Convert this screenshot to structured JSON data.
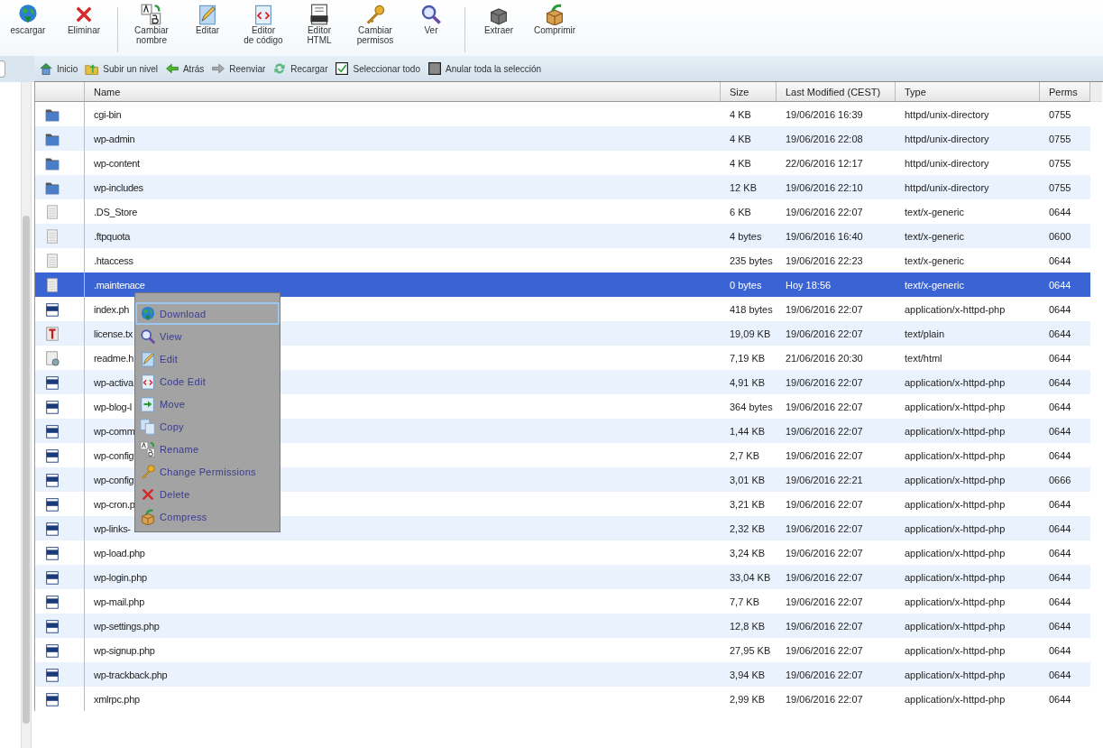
{
  "toolbar": [
    {
      "kind": "download",
      "label": "escargar"
    },
    {
      "kind": "delete",
      "label": "Eliminar"
    },
    {
      "kind": "sep"
    },
    {
      "kind": "rename",
      "label": "Cambiar nombre"
    },
    {
      "kind": "edit",
      "label": "Editar"
    },
    {
      "kind": "code",
      "label": "Editor de código"
    },
    {
      "kind": "html",
      "label": "Editor HTML"
    },
    {
      "kind": "key",
      "label": "Cambiar permisos"
    },
    {
      "kind": "view",
      "label": "Ver"
    },
    {
      "kind": "sep"
    },
    {
      "kind": "extract",
      "label": "Extraer"
    },
    {
      "kind": "compress",
      "label": "Comprimir"
    }
  ],
  "nav": [
    {
      "kind": "home",
      "label": "Inicio"
    },
    {
      "kind": "up",
      "label": "Subir un nivel"
    },
    {
      "kind": "back",
      "label": "Atrás"
    },
    {
      "kind": "forward",
      "label": "Reenviar"
    },
    {
      "kind": "reload",
      "label": "Recargar"
    },
    {
      "kind": "selectall",
      "label": "Seleccionar todo"
    },
    {
      "kind": "unselect",
      "label": "Anular toda la selección"
    }
  ],
  "table": {
    "columns": [
      "Name",
      "Size",
      "Last Modified (CEST)",
      "Type",
      "Perms"
    ],
    "rows": [
      {
        "kind": "folder",
        "name": "cgi-bin",
        "size": "4 KB",
        "modified": "19/06/2016 16:39",
        "type": "httpd/unix-directory",
        "perms": "0755",
        "selected": false
      },
      {
        "kind": "folder",
        "name": "wp-admin",
        "size": "4 KB",
        "modified": "19/06/2016 22:08",
        "type": "httpd/unix-directory",
        "perms": "0755",
        "selected": false
      },
      {
        "kind": "folder",
        "name": "wp-content",
        "size": "4 KB",
        "modified": "22/06/2016 12:17",
        "type": "httpd/unix-directory",
        "perms": "0755",
        "selected": false
      },
      {
        "kind": "folder",
        "name": "wp-includes",
        "size": "12 KB",
        "modified": "19/06/2016 22:10",
        "type": "httpd/unix-directory",
        "perms": "0755",
        "selected": false
      },
      {
        "kind": "generic",
        "name": ".DS_Store",
        "size": "6 KB",
        "modified": "19/06/2016 22:07",
        "type": "text/x-generic",
        "perms": "0644",
        "selected": false
      },
      {
        "kind": "generic",
        "name": ".ftpquota",
        "size": "4 bytes",
        "modified": "19/06/2016 16:40",
        "type": "text/x-generic",
        "perms": "0600",
        "selected": false
      },
      {
        "kind": "generic",
        "name": ".htaccess",
        "size": "235 bytes",
        "modified": "19/06/2016 22:23",
        "type": "text/x-generic",
        "perms": "0644",
        "selected": false
      },
      {
        "kind": "generic",
        "name": ".maintenace",
        "size": "0 bytes",
        "modified": "Hoy 18:56",
        "type": "text/x-generic",
        "perms": "0644",
        "selected": true
      },
      {
        "kind": "php",
        "name": "index.ph",
        "size": "418 bytes",
        "modified": "19/06/2016 22:07",
        "type": "application/x-httpd-php",
        "perms": "0644",
        "selected": false
      },
      {
        "kind": "text",
        "name": "license.tx",
        "size": "19,09 KB",
        "modified": "19/06/2016 22:07",
        "type": "text/plain",
        "perms": "0644",
        "selected": false
      },
      {
        "kind": "html",
        "name": "readme.h",
        "size": "7,19 KB",
        "modified": "21/06/2016 20:30",
        "type": "text/html",
        "perms": "0644",
        "selected": false
      },
      {
        "kind": "php",
        "name": "wp-activa",
        "size": "4,91 KB",
        "modified": "19/06/2016 22:07",
        "type": "application/x-httpd-php",
        "perms": "0644",
        "selected": false
      },
      {
        "kind": "php",
        "name": "wp-blog-l",
        "size": "364 bytes",
        "modified": "19/06/2016 22:07",
        "type": "application/x-httpd-php",
        "perms": "0644",
        "selected": false
      },
      {
        "kind": "php",
        "name": "wp-comm",
        "size": "1,44 KB",
        "modified": "19/06/2016 22:07",
        "type": "application/x-httpd-php",
        "perms": "0644",
        "selected": false
      },
      {
        "kind": "php",
        "name": "wp-config",
        "size": "2,7 KB",
        "modified": "19/06/2016 22:07",
        "type": "application/x-httpd-php",
        "perms": "0644",
        "selected": false
      },
      {
        "kind": "php",
        "name": "wp-config",
        "size": "3,01 KB",
        "modified": "19/06/2016 22:21",
        "type": "application/x-httpd-php",
        "perms": "0666",
        "selected": false
      },
      {
        "kind": "php",
        "name": "wp-cron.p",
        "size": "3,21 KB",
        "modified": "19/06/2016 22:07",
        "type": "application/x-httpd-php",
        "perms": "0644",
        "selected": false
      },
      {
        "kind": "php",
        "name": "wp-links-",
        "size": "2,32 KB",
        "modified": "19/06/2016 22:07",
        "type": "application/x-httpd-php",
        "perms": "0644",
        "selected": false
      },
      {
        "kind": "php",
        "name": "wp-load.php",
        "size": "3,24 KB",
        "modified": "19/06/2016 22:07",
        "type": "application/x-httpd-php",
        "perms": "0644",
        "selected": false
      },
      {
        "kind": "php",
        "name": "wp-login.php",
        "size": "33,04 KB",
        "modified": "19/06/2016 22:07",
        "type": "application/x-httpd-php",
        "perms": "0644",
        "selected": false
      },
      {
        "kind": "php",
        "name": "wp-mail.php",
        "size": "7,7 KB",
        "modified": "19/06/2016 22:07",
        "type": "application/x-httpd-php",
        "perms": "0644",
        "selected": false
      },
      {
        "kind": "php",
        "name": "wp-settings.php",
        "size": "12,8 KB",
        "modified": "19/06/2016 22:07",
        "type": "application/x-httpd-php",
        "perms": "0644",
        "selected": false
      },
      {
        "kind": "php",
        "name": "wp-signup.php",
        "size": "27,95 KB",
        "modified": "19/06/2016 22:07",
        "type": "application/x-httpd-php",
        "perms": "0644",
        "selected": false
      },
      {
        "kind": "php",
        "name": "wp-trackback.php",
        "size": "3,94 KB",
        "modified": "19/06/2016 22:07",
        "type": "application/x-httpd-php",
        "perms": "0644",
        "selected": false
      },
      {
        "kind": "php",
        "name": "xmlrpc.php",
        "size": "2,99 KB",
        "modified": "19/06/2016 22:07",
        "type": "application/x-httpd-php",
        "perms": "0644",
        "selected": false
      }
    ]
  },
  "context_menu": [
    {
      "kind": "download",
      "label": "Download",
      "selected": true
    },
    {
      "kind": "view",
      "label": "View",
      "selected": false
    },
    {
      "kind": "edit",
      "label": "Edit",
      "selected": false
    },
    {
      "kind": "code",
      "label": "Code Edit",
      "selected": false
    },
    {
      "kind": "move",
      "label": "Move",
      "selected": false
    },
    {
      "kind": "copy",
      "label": "Copy",
      "selected": false
    },
    {
      "kind": "rename",
      "label": "Rename",
      "selected": false
    },
    {
      "kind": "key",
      "label": "Change Permissions",
      "selected": false
    },
    {
      "kind": "delete",
      "label": "Delete",
      "selected": false
    },
    {
      "kind": "compress",
      "label": "Compress",
      "selected": false
    }
  ]
}
